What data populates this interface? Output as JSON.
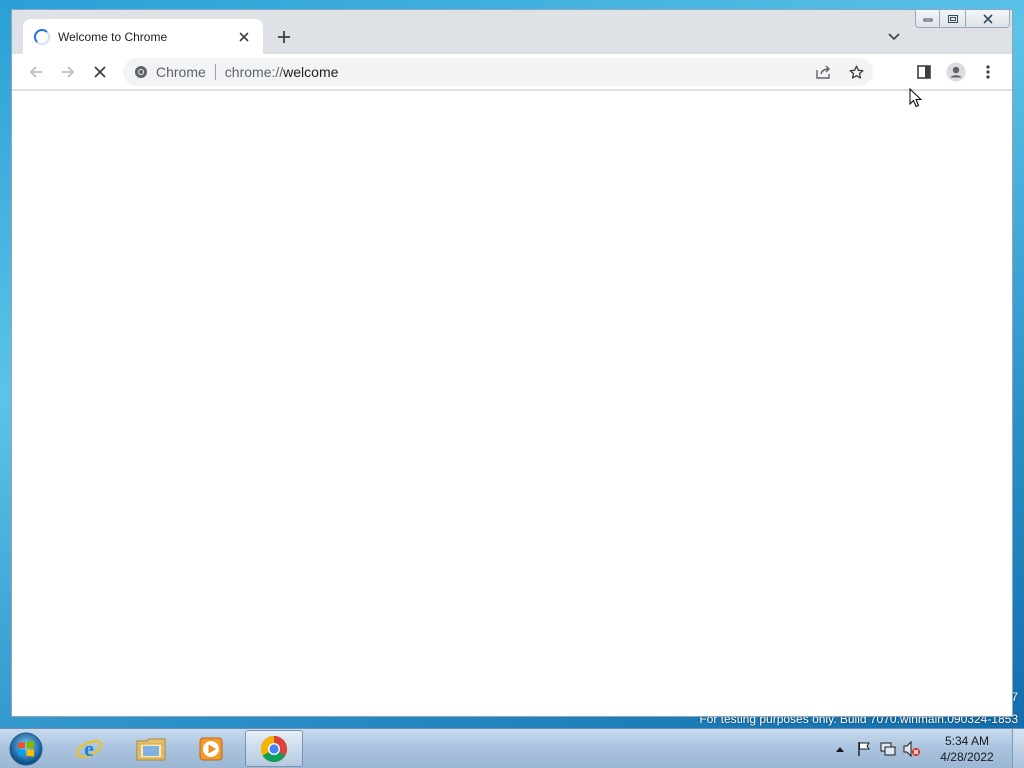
{
  "window": {
    "tab": {
      "title": "Welcome to Chrome",
      "loading_icon": "loading-spinner-icon",
      "close_icon": "close-icon"
    },
    "new_tab_icon": "plus-icon",
    "tab_search_icon": "chevron-down-icon",
    "caption_buttons": [
      "minimize-icon",
      "restore-icon",
      "close-icon"
    ]
  },
  "toolbar": {
    "back_icon": "arrow-left-icon",
    "forward_icon": "arrow-right-icon",
    "stop_icon": "stop-x-icon",
    "omnibox": {
      "chip_icon": "chrome-logo-icon",
      "chip_label": "Chrome",
      "url_scheme": "chrome://",
      "url_host": "welcome"
    },
    "share_icon": "share-icon",
    "bookmark_icon": "star-icon",
    "side_panel_icon": "side-panel-icon",
    "profile_icon": "profile-avatar-icon",
    "menu_icon": "kebab-menu-icon"
  },
  "taskbar": {
    "start_icon": "windows-start-orb-icon",
    "pinned": [
      {
        "name": "internet-explorer",
        "icon": "ie-icon"
      },
      {
        "name": "file-explorer",
        "icon": "folder-icon"
      },
      {
        "name": "media-player",
        "icon": "media-player-icon"
      },
      {
        "name": "chrome",
        "icon": "chrome-icon",
        "active": true
      }
    ],
    "tray_icons": [
      "show-hidden-icon",
      "action-center-flag-icon",
      "network-icon",
      "volume-muted-icon"
    ],
    "clock": {
      "time": "5:34 AM",
      "date": "4/28/2022"
    }
  },
  "desktop": {
    "watermark": "For testing purposes only. Build 7070.winmain.090324-1853",
    "build_number": "7"
  },
  "colors": {
    "tab_strip": "#dee1e6",
    "omnibox_bg": "#f1f3f4",
    "accent": "#1a73e8"
  }
}
